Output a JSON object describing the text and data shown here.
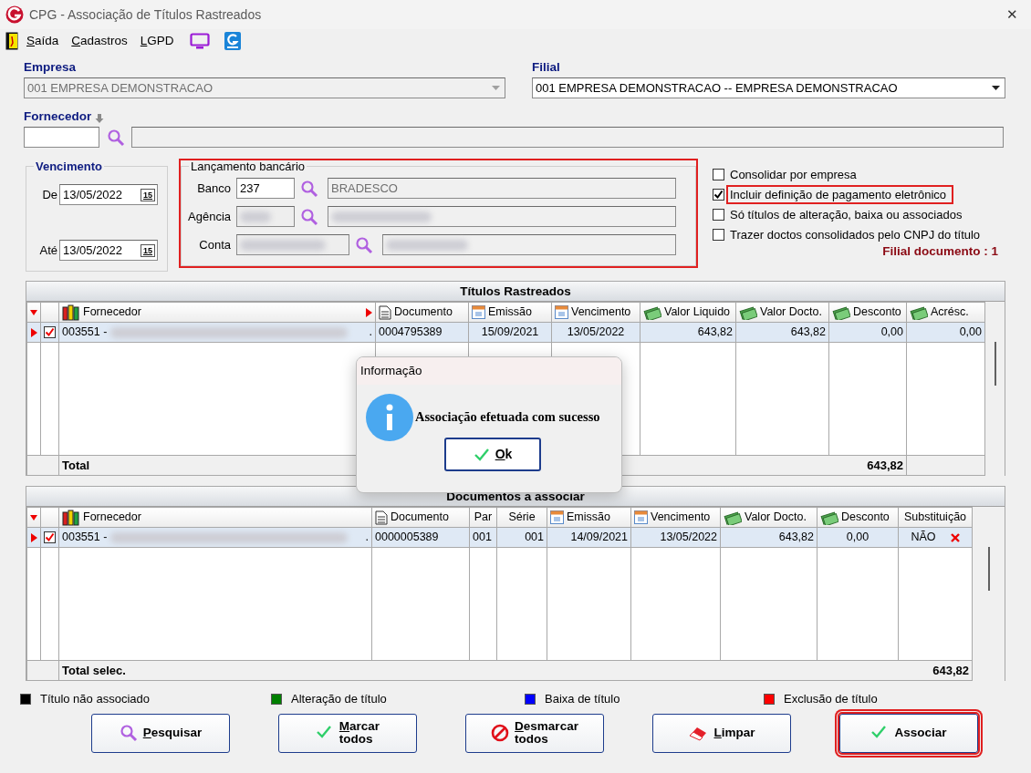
{
  "window": {
    "title": "CPG - Associação de Títulos Rastreados",
    "close": "✕"
  },
  "menu": [
    {
      "label": "Saída"
    },
    {
      "label": "Cadastros"
    },
    {
      "label": "LGPD"
    }
  ],
  "empresa": {
    "label": "Empresa",
    "value": "001 EMPRESA DEMONSTRACAO",
    "disabled": true
  },
  "filial": {
    "label": "Filial",
    "value": "001 EMPRESA DEMONSTRACAO -- EMPRESA DEMONSTRACAO",
    "disabled": false
  },
  "fornecedor": {
    "label": "Fornecedor"
  },
  "vencimento": {
    "title": "Vencimento",
    "from_label": "De",
    "from": "13/05/2022",
    "from_calendar": "15",
    "to_label": "Até",
    "to": "13/05/2022",
    "to_calendar": "15"
  },
  "lancamento": {
    "title": "Lançamento bancário",
    "highlighted": true,
    "fields": [
      {
        "label": "Banco",
        "value": "237",
        "description": "BRADESCO",
        "redacted": false
      },
      {
        "label": "Agência",
        "redacted": true
      },
      {
        "label": "Conta",
        "redacted": true
      }
    ]
  },
  "options": [
    {
      "label": "Consolidar por empresa",
      "checked": false,
      "highlighted": false
    },
    {
      "label": "Incluir definição de pagamento eletrônico",
      "checked": true,
      "highlighted": true
    },
    {
      "label": "Só títulos de alteração, baixa ou associados",
      "checked": false,
      "highlighted": false
    },
    {
      "label": "Trazer doctos consolidados pelo CNPJ do título",
      "checked": false,
      "highlighted": false
    }
  ],
  "filial_documento": "Filial documento : 1",
  "grids": [
    {
      "title": "Títulos Rastreados",
      "columns": [
        {
          "label": "Fornecedor",
          "kind": "supplier",
          "sorted": true
        },
        {
          "label": "Documento",
          "kind": "document",
          "sorted": false
        },
        {
          "label": "Emissão",
          "kind": "date",
          "sorted": false
        },
        {
          "label": "Vencimento",
          "kind": "date",
          "sorted": false
        },
        {
          "label": "Valor Liquido",
          "kind": "amount",
          "sorted": false
        },
        {
          "label": "Valor Docto.",
          "kind": "amount",
          "sorted": false
        },
        {
          "label": "Desconto",
          "kind": "amount",
          "sorted": false
        },
        {
          "label": "Acrésc.",
          "kind": "amount",
          "sorted": false
        }
      ],
      "rows": [
        {
          "selected": true,
          "checked": true,
          "redacted": true,
          "suffix": ".",
          "cells": [
            "003551 -",
            "0004795389",
            "15/09/2021",
            "13/05/2022",
            "643,82",
            "643,82",
            "0,00",
            "0,00"
          ],
          "deletable": false
        }
      ],
      "total": {
        "label": "Total",
        "value": "643,82"
      }
    },
    {
      "title": "Documentos a associar",
      "columns": [
        {
          "label": "Fornecedor",
          "kind": "supplier",
          "sorted": false
        },
        {
          "label": "Documento",
          "kind": "document",
          "sorted": false
        },
        {
          "label": "Par",
          "kind": "text",
          "sorted": false
        },
        {
          "label": "Série",
          "kind": "text",
          "sorted": false
        },
        {
          "label": "Emissão",
          "kind": "date",
          "sorted": false
        },
        {
          "label": "Vencimento",
          "kind": "date",
          "sorted": false
        },
        {
          "label": "Valor Docto.",
          "kind": "amount",
          "sorted": false
        },
        {
          "label": "Desconto",
          "kind": "amount",
          "sorted": false
        },
        {
          "label": "Substituição",
          "kind": "text",
          "sorted": false
        }
      ],
      "rows": [
        {
          "selected": true,
          "checked": true,
          "redacted": true,
          "suffix": ".",
          "cells": [
            "003551 -",
            "0000005389",
            "001",
            "001",
            "14/09/2021",
            "13/05/2022",
            "643,82",
            "0,00",
            "NÃO"
          ],
          "deletable": true
        }
      ],
      "total": {
        "label": "Total selec.",
        "value": "643,82"
      }
    }
  ],
  "legend": [
    {
      "label": "Título não associado",
      "color": "#000000"
    },
    {
      "label": "Alteração de título",
      "color": "#008000"
    },
    {
      "label": "Baixa de título",
      "color": "#0000ff"
    },
    {
      "label": "Exclusão de título",
      "color": "#ff0000"
    }
  ],
  "buttons": [
    {
      "label": "Pesquisar",
      "kind": "search",
      "mnemonic": true,
      "highlighted": false
    },
    {
      "label": "Marcar todos",
      "kind": "select_all",
      "mnemonic": true,
      "highlighted": false
    },
    {
      "label": "Desmarcar todos",
      "kind": "deselect_all",
      "mnemonic": true,
      "highlighted": false
    },
    {
      "label": "Limpar",
      "kind": "clear",
      "mnemonic": true,
      "highlighted": false
    },
    {
      "label": "Associar",
      "kind": "confirm",
      "mnemonic": false,
      "highlighted": true
    }
  ],
  "dialog": {
    "title": "Informação",
    "message": "Associação efetuada com sucesso",
    "button": "Ok"
  }
}
